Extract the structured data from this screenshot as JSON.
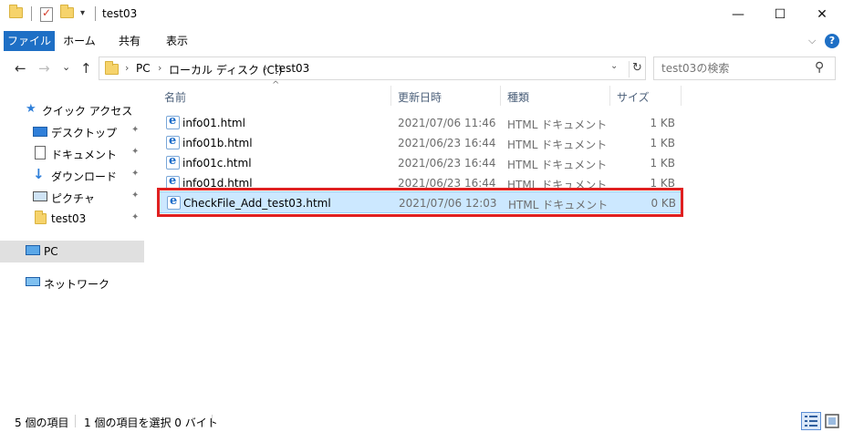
{
  "window": {
    "title": "test03",
    "minimize": "—",
    "maximize": "☐",
    "close": "✕"
  },
  "ribbon": {
    "tabs": [
      "ファイル",
      "ホーム",
      "共有",
      "表示"
    ],
    "expand_icon": "chevron-down-icon",
    "help": "?"
  },
  "nav": {
    "back": "←",
    "forward": "→",
    "recent": "⌄",
    "up": "↑"
  },
  "address": {
    "crumbs": [
      "PC",
      "ローカル ディスク (C:)",
      "test03"
    ],
    "separator": "›",
    "dropdown": "⌄",
    "refresh": "↻"
  },
  "search": {
    "placeholder": "test03の検索",
    "icon": "⚲"
  },
  "sidebar": {
    "items": [
      {
        "label": "クイック アクセス",
        "icon": "star-icon"
      },
      {
        "label": "デスクトップ",
        "icon": "desktop-icon",
        "pinned": true
      },
      {
        "label": "ドキュメント",
        "icon": "document-icon",
        "pinned": true
      },
      {
        "label": "ダウンロード",
        "icon": "download-icon",
        "pinned": true
      },
      {
        "label": "ピクチャ",
        "icon": "pictures-icon",
        "pinned": true
      },
      {
        "label": "test03",
        "icon": "folder-icon",
        "pinned": true
      },
      {
        "label": "PC",
        "icon": "pc-icon"
      },
      {
        "label": "ネットワーク",
        "icon": "network-icon"
      }
    ],
    "pin_glyph": "📌"
  },
  "columns": {
    "name": "名前",
    "modified": "更新日時",
    "type": "種類",
    "size": "サイズ",
    "sort_caret": "^"
  },
  "files": [
    {
      "name": "info01.html",
      "modified": "2021/07/06 11:46",
      "type": "HTML ドキュメント",
      "size": "1 KB"
    },
    {
      "name": "info01b.html",
      "modified": "2021/06/23 16:44",
      "type": "HTML ドキュメント",
      "size": "1 KB"
    },
    {
      "name": "info01c.html",
      "modified": "2021/06/23 16:44",
      "type": "HTML ドキュメント",
      "size": "1 KB"
    },
    {
      "name": "info01d.html",
      "modified": "2021/06/23 16:44",
      "type": "HTML ドキュメント",
      "size": "1 KB"
    },
    {
      "name": "CheckFile_Add_test03.html",
      "modified": "2021/07/06 12:03",
      "type": "HTML ドキュメント",
      "size": "0 KB",
      "selected": true
    }
  ],
  "status": {
    "item_count": "5 個の項目",
    "selected": "1 個の項目を選択  0 バイト"
  },
  "colors": {
    "accent": "#1e6fc5",
    "selection": "#cce8ff",
    "highlight_box": "#e02020"
  }
}
